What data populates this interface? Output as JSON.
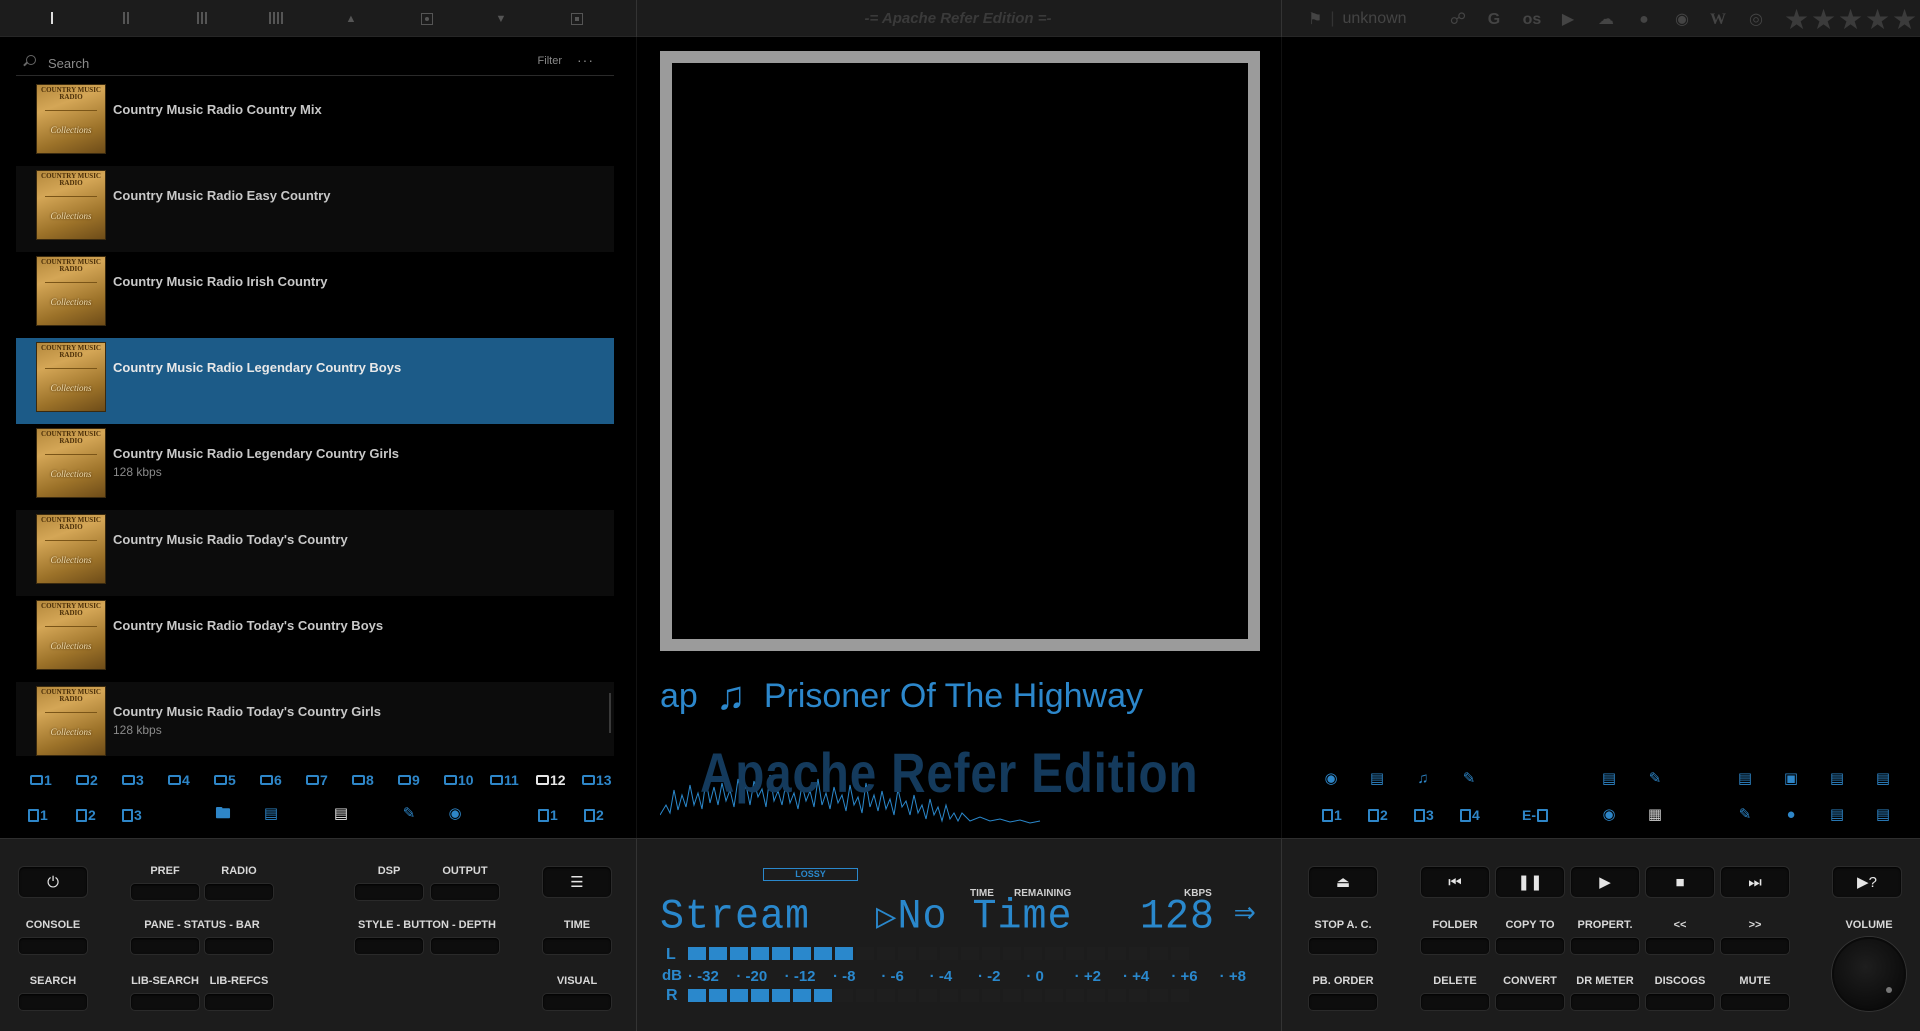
{
  "window": {
    "title": "-= Apache Refer Edition =-"
  },
  "top_tabs": [
    {
      "name": "layout-1",
      "icon": "bar-1-icon"
    },
    {
      "name": "layout-2",
      "icon": "bars-2-icon"
    },
    {
      "name": "layout-3",
      "icon": "bars-3-icon"
    },
    {
      "name": "layout-4",
      "icon": "bars-4-icon"
    },
    {
      "name": "layout-5",
      "icon": "box-up-icon"
    },
    {
      "name": "layout-6",
      "icon": "box-dot-icon"
    },
    {
      "name": "layout-7",
      "icon": "box-down-icon"
    },
    {
      "name": "layout-8",
      "icon": "box-square-icon"
    }
  ],
  "country": {
    "flag_icon": "flag-icon",
    "label": "unknown"
  },
  "source_icons": [
    "link-icon",
    "google-icon",
    "lastfm-icon",
    "youtube-icon",
    "soundcloud-icon",
    "spotify-icon",
    "discogs-icon",
    "wikipedia-icon",
    "podcast-icon"
  ],
  "rating": {
    "stars": 5,
    "filled": 0
  },
  "library": {
    "search_placeholder": "Search",
    "filter_label": "Filter",
    "more_label": "···",
    "items": [
      {
        "title": "Country Music Radio Country Mix",
        "subtitle": "",
        "cover_caption": "Collections"
      },
      {
        "title": "Country Music Radio Easy Country",
        "subtitle": "",
        "cover_caption": "Collections"
      },
      {
        "title": "Country Music Radio Irish Country",
        "subtitle": "",
        "cover_caption": "Collections"
      },
      {
        "title": "Country Music Radio Legendary Country Boys",
        "subtitle": "",
        "cover_caption": "Collections",
        "selected": true
      },
      {
        "title": "Country Music Radio Legendary Country Girls",
        "subtitle": "128 kbps",
        "cover_caption": "Collections"
      },
      {
        "title": "Country Music Radio Today's Country",
        "subtitle": "",
        "cover_caption": "Collections"
      },
      {
        "title": "Country Music Radio Today's Country Boys",
        "subtitle": "",
        "cover_caption": "Collections"
      },
      {
        "title": "Country Music Radio Today's Country Girls",
        "subtitle": "128 kbps",
        "cover_caption": "Collections"
      }
    ],
    "cover_header": "COUNTRY MUSIC RADIO"
  },
  "playlist_tabs": [
    "1",
    "2",
    "3",
    "4",
    "5",
    "6",
    "7",
    "8",
    "9",
    "10",
    "11",
    "12",
    "13"
  ],
  "active_playlist_tab": "12",
  "sub_tabs": [
    "1",
    "2",
    "3"
  ],
  "panel_tabs": [
    "1",
    "2"
  ],
  "now_playing": {
    "prefix": "ap",
    "title": "Prisoner Of The Highway",
    "watermark": "Apache Refer Edition"
  },
  "right_tabs": {
    "doc_tabs": [
      "1",
      "2",
      "3",
      "4"
    ],
    "edoc_label": "E-"
  },
  "controls_left": {
    "row1": [
      "PREF",
      "RADIO",
      "DSP",
      "OUTPUT"
    ],
    "row2": [
      "CONSOLE",
      "PANE - STATUS - BAR",
      "STYLE - BUTTON - DEPTH",
      "TIME"
    ],
    "row3": [
      "SEARCH",
      "LIB-SEARCH",
      "LIB-REFCS",
      "VISUAL"
    ]
  },
  "display": {
    "lossy": "LOSSY",
    "time_label": "TIME",
    "remaining_label": "REMAINING",
    "kbps_label": "KBPS",
    "stream_text": "Stream",
    "time_text": "No Time",
    "kbps_value": "128",
    "left_label": "L",
    "right_label": "R",
    "db_label": "dB",
    "db_ticks": [
      "-32",
      "-20",
      "-12",
      "-8",
      "-6",
      "-4",
      "-2",
      "0",
      "+2",
      "+4",
      "+6",
      "+8"
    ],
    "left_level_segments": 8,
    "right_level_segments": 7,
    "total_segments": 24
  },
  "controls_right": {
    "row2": [
      "STOP A. C.",
      "FOLDER",
      "COPY TO",
      "PROPERT.",
      "<<",
      ">>",
      "VOLUME"
    ],
    "row3": [
      "PB. ORDER",
      "DELETE",
      "CONVERT",
      "DR METER",
      "DISCOGS",
      "MUTE"
    ],
    "help_label": "?"
  },
  "colors": {
    "accent": "#2a88cc",
    "selection": "#1c5b88",
    "panel": "#1c1c1c"
  }
}
